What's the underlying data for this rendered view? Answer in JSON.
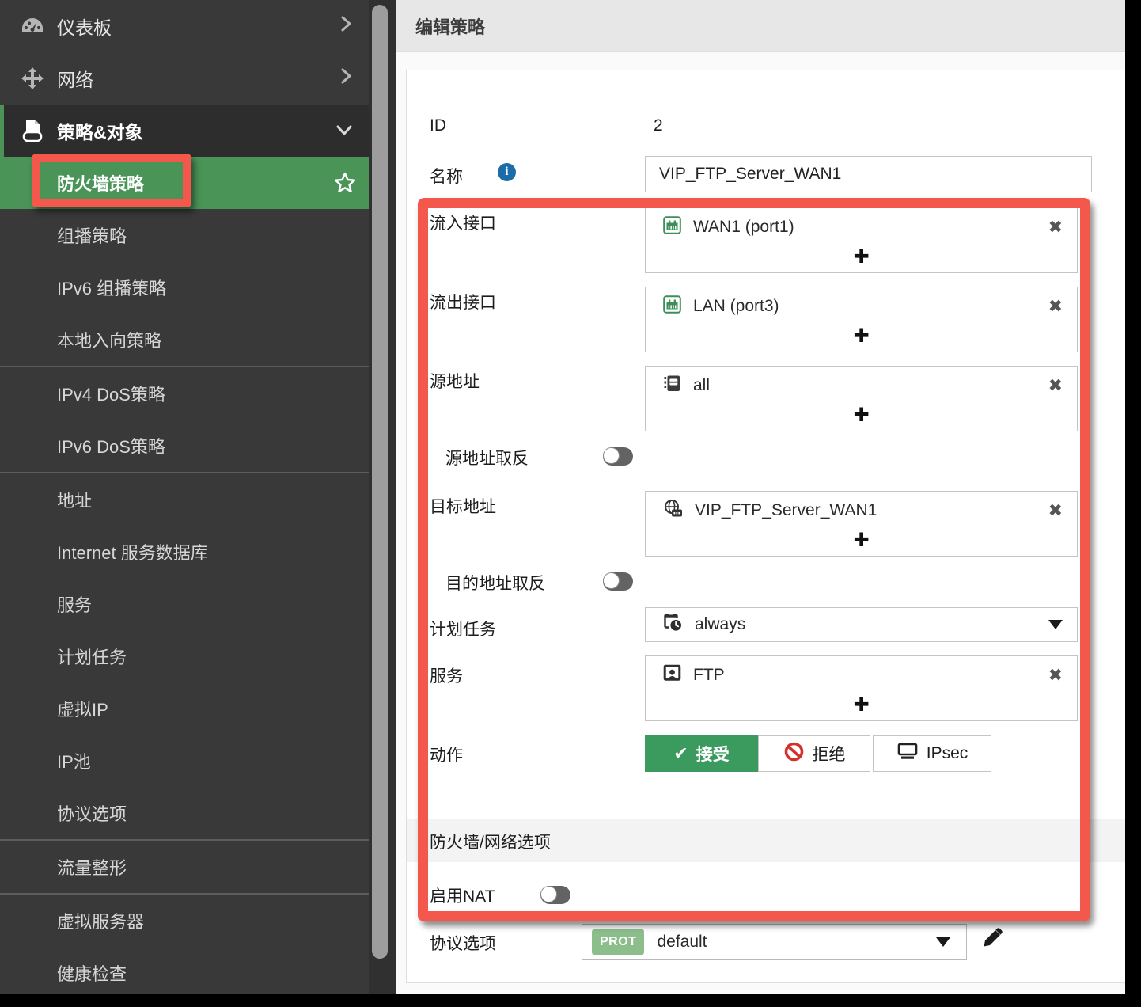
{
  "colors": {
    "annotation_red": "#f4584c",
    "sidebar_green": "#4a9458",
    "accept_green": "#3b9b5f",
    "badge_green": "#8cbe8c",
    "info_blue": "#1b6ca8",
    "deny_red": "#d2322d"
  },
  "sidebar": {
    "top_items": [
      {
        "label": "仪表板",
        "icon": "dashboard-icon"
      },
      {
        "label": "网络",
        "icon": "network-icon"
      },
      {
        "label": "策略&对象",
        "icon": "policy-icon"
      }
    ],
    "sub_items": [
      {
        "label": "防火墙策略"
      },
      {
        "label": "组播策略"
      },
      {
        "label": "IPv6 组播策略"
      },
      {
        "label": "本地入向策略"
      },
      {
        "label": "IPv4 DoS策略"
      },
      {
        "label": "IPv6 DoS策略"
      },
      {
        "label": "地址"
      },
      {
        "label": "Internet 服务数据库"
      },
      {
        "label": "服务"
      },
      {
        "label": "计划任务"
      },
      {
        "label": "虚拟IP"
      },
      {
        "label": "IP池"
      },
      {
        "label": "协议选项"
      },
      {
        "label": "流量整形"
      },
      {
        "label": "虚拟服务器"
      },
      {
        "label": "健康检查"
      }
    ]
  },
  "header": {
    "title": "编辑策略"
  },
  "form": {
    "id_label": "ID",
    "id_value": "2",
    "name_label": "名称",
    "name_value": "VIP_FTP_Server_WAN1",
    "incoming_label": "流入接口",
    "incoming_value": "WAN1 (port1)",
    "outgoing_label": "流出接口",
    "outgoing_value": "LAN (port3)",
    "source_label": "源地址",
    "source_value": "all",
    "negate_source_label": "源地址取反",
    "dest_label": "目标地址",
    "dest_value": "VIP_FTP_Server_WAN1",
    "negate_dest_label": "目的地址取反",
    "schedule_label": "计划任务",
    "schedule_value": "always",
    "service_label": "服务",
    "service_value": "FTP",
    "action_label": "动作",
    "action_accept": "接受",
    "action_deny": "拒绝",
    "action_ipsec": "IPsec",
    "section_title": "防火墙/网络选项",
    "nat_label": "启用NAT",
    "protocol_label": "协议选项",
    "protocol_badge": "PROT",
    "protocol_value": "default",
    "remove_glyph": "✖",
    "add_glyph": "✚",
    "check_glyph": "✔"
  }
}
